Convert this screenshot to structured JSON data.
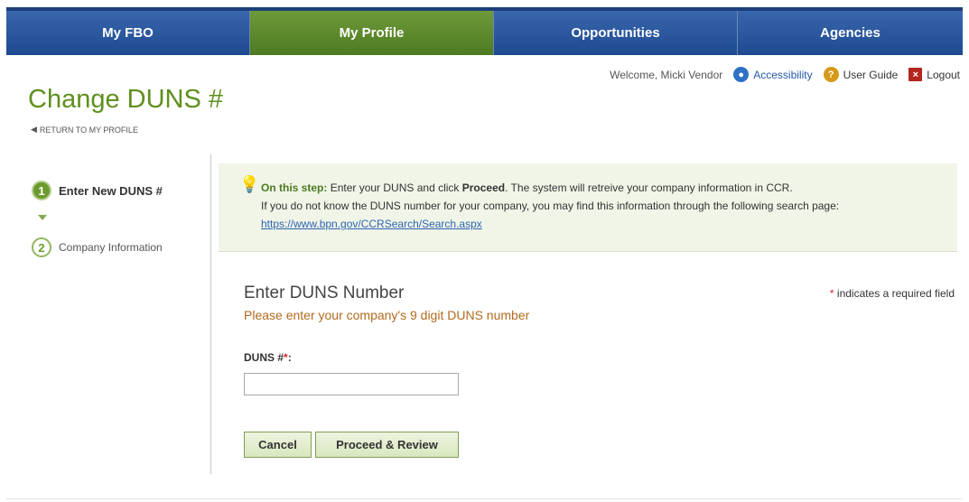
{
  "nav": {
    "tabs": [
      {
        "label": "My FBO",
        "active": false
      },
      {
        "label": "My Profile",
        "active": true
      },
      {
        "label": "Opportunities",
        "active": false
      },
      {
        "label": "Agencies",
        "active": false
      }
    ]
  },
  "utility": {
    "welcome": "Welcome, Micki Vendor",
    "accessibility": "Accessibility",
    "user_guide": "User Guide",
    "logout": "Logout"
  },
  "page": {
    "title": "Change DUNS #",
    "return_link": "RETURN TO MY PROFILE"
  },
  "steps": [
    {
      "number": "1",
      "label": "Enter New DUNS #",
      "active": true
    },
    {
      "number": "2",
      "label": "Company Information",
      "active": false
    }
  ],
  "info": {
    "lead": "On this step:",
    "text_1": "Enter your DUNS and click",
    "proceed_word": "Proceed",
    "text_2": ". The system will retreive your company information in CCR.",
    "text_3": "If you do not know the DUNS number for your company, you may find this information through the following search page:",
    "link": "https://www.bpn.gov/CCRSearch/Search.aspx"
  },
  "form": {
    "heading": "Enter DUNS Number",
    "subtitle": "Please enter your company's 9 digit DUNS number",
    "required_star": "*",
    "required_text": "indicates a required field",
    "duns_label": "DUNS #",
    "duns_star": "*",
    "duns_colon": ":",
    "duns_value": "",
    "cancel_label": "Cancel",
    "proceed_label": "Proceed & Review"
  },
  "icons": {
    "accessibility": "accessibility-icon",
    "user_guide": "help-icon",
    "logout": "close-icon",
    "lightbulb": "lightbulb-icon",
    "return": "left-arrow-icon",
    "step_arrow": "down-arrow-icon"
  },
  "colors": {
    "nav_blue": "#1d4a90",
    "nav_active_green": "#4d7a22",
    "title_green": "#5f8f1e",
    "subtitle_orange": "#b16a1d",
    "link_blue": "#2d63b4",
    "required_red": "#dd2222"
  }
}
